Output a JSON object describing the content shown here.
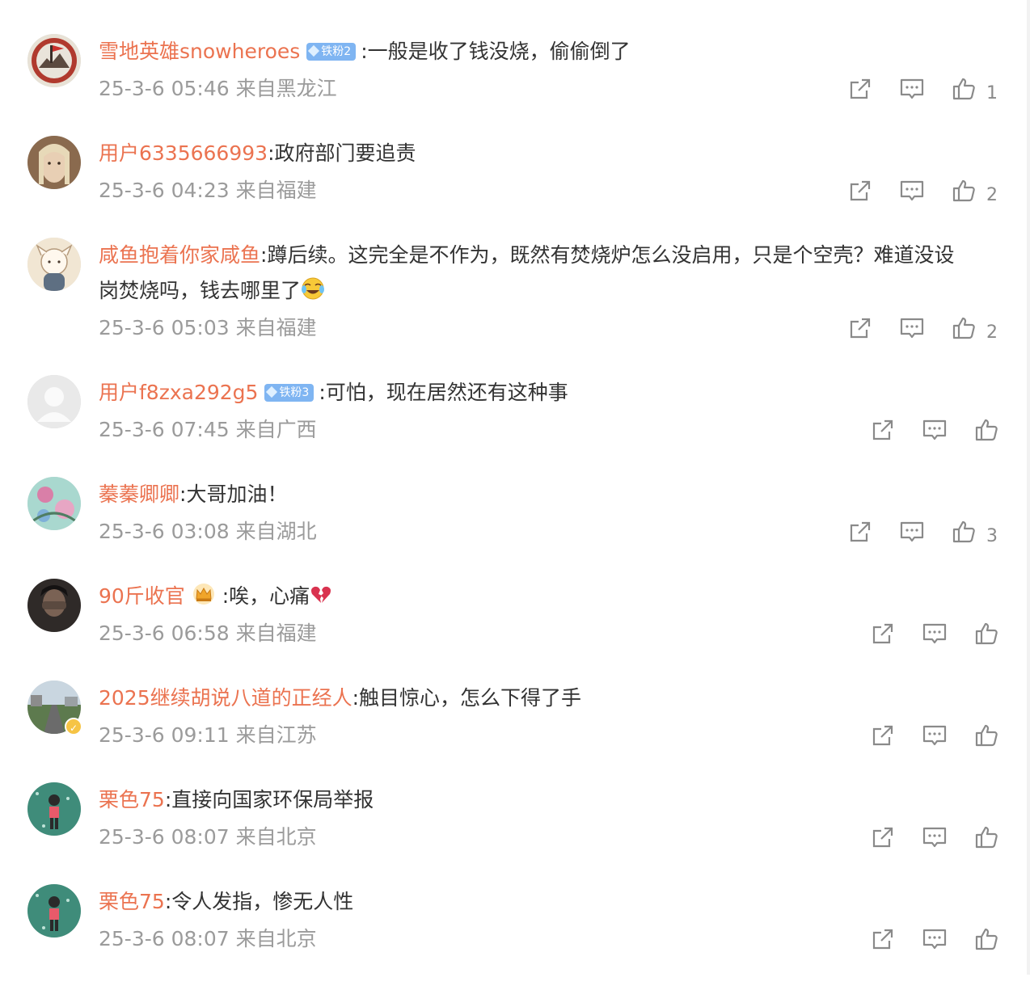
{
  "comments": [
    {
      "user": "雪地英雄snowheroes",
      "fan_badge": "铁粉2",
      "text": ":一般是收了钱没烧，偷偷倒了",
      "time": "25-3-6 05:46",
      "location": "来自黑龙江",
      "likes": "1",
      "avatar_color": "#8b3a2f"
    },
    {
      "user": "用户6335666993",
      "text": ":政府部门要追责",
      "time": "25-3-6 04:23",
      "location": "来自福建",
      "likes": "2",
      "avatar_color": "#c9a47e"
    },
    {
      "user": "咸鱼抱着你家咸鱼",
      "text": ":蹲后续。这完全是不作为，既然有焚烧炉怎么没启用，只是个空壳？难道没设",
      "text2": "岗焚烧吗，钱去哪里了",
      "time": "25-3-6 05:03",
      "location": "来自福建",
      "likes": "2",
      "avatar_color": "#efe3cf"
    },
    {
      "user": "用户f8zxa292g5",
      "fan_badge": "铁粉3",
      "text": ":可怕，现在居然还有这种事",
      "time": "25-3-6 07:45",
      "location": "来自广西",
      "likes": "",
      "avatar_color": "#e6e6e6"
    },
    {
      "user": "蓁蓁卿卿",
      "text": ":大哥加油！",
      "time": "25-3-6 03:08",
      "location": "来自湖北",
      "likes": "3",
      "avatar_color": "#9ccfc4"
    },
    {
      "user": "90斤收官",
      "text": ":唉，心痛",
      "time": "25-3-6 06:58",
      "location": "来自福建",
      "likes": "",
      "avatar_color": "#3a3330"
    },
    {
      "user": "2025继续胡说八道的正经人",
      "text": ":触目惊心，怎么下得了手",
      "time": "25-3-6 09:11",
      "location": "来自江苏",
      "likes": "",
      "avatar_color": "#6f8a6a"
    },
    {
      "user": "栗色75",
      "text": ":直接向国家环保局举报",
      "time": "25-3-6 08:07",
      "location": "来自北京",
      "likes": "",
      "avatar_color": "#3f8c7a"
    },
    {
      "user": "栗色75",
      "text": ":令人发指，惨无人性",
      "time": "25-3-6 08:07",
      "location": "来自北京",
      "likes": "",
      "avatar_color": "#3f8c7a"
    }
  ],
  "icons": {
    "share": "share-icon",
    "comment": "comment-icon",
    "like": "thumbs-up-icon"
  },
  "colors": {
    "username": "#eb7350",
    "meta": "#9b9b9b",
    "icon": "#8a8a8a",
    "fan_badge": "#7fb5f2"
  }
}
